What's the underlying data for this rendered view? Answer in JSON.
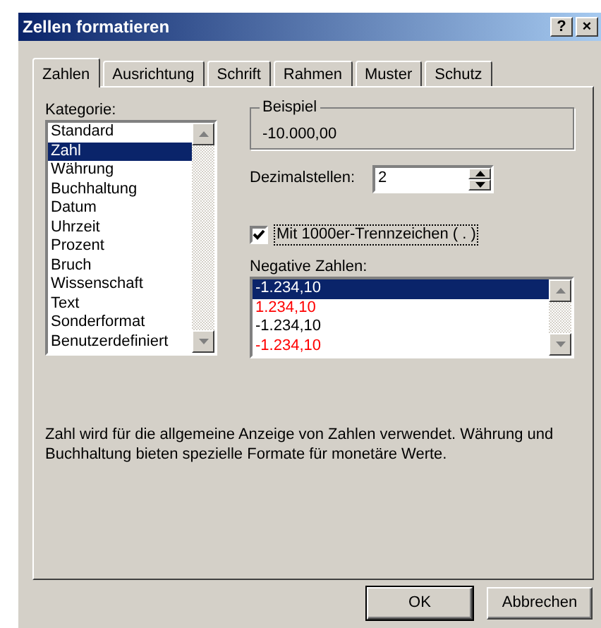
{
  "window": {
    "title": "Zellen formatieren",
    "title_buttons": [
      "?",
      "×"
    ]
  },
  "tabs": [
    {
      "label": "Zahlen",
      "selected": true
    },
    {
      "label": "Ausrichtung",
      "selected": false
    },
    {
      "label": "Schrift",
      "selected": false
    },
    {
      "label": "Rahmen",
      "selected": false
    },
    {
      "label": "Muster",
      "selected": false
    },
    {
      "label": "Schutz",
      "selected": false
    }
  ],
  "category": {
    "label": "Kategorie:",
    "items": [
      {
        "label": "Standard",
        "selected": false
      },
      {
        "label": "Zahl",
        "selected": true
      },
      {
        "label": "Währung",
        "selected": false
      },
      {
        "label": "Buchhaltung",
        "selected": false
      },
      {
        "label": "Datum",
        "selected": false
      },
      {
        "label": "Uhrzeit",
        "selected": false
      },
      {
        "label": "Prozent",
        "selected": false
      },
      {
        "label": "Bruch",
        "selected": false
      },
      {
        "label": "Wissenschaft",
        "selected": false
      },
      {
        "label": "Text",
        "selected": false
      },
      {
        "label": "Sonderformat",
        "selected": false
      },
      {
        "label": "Benutzerdefiniert",
        "selected": false
      }
    ]
  },
  "sample": {
    "label": "Beispiel",
    "value": "-10.000,00"
  },
  "decimal_places": {
    "label": "Dezimalstellen:",
    "value": "2"
  },
  "thousands_separator": {
    "label": "Mit 1000er-Trennzeichen ( . )",
    "checked": true
  },
  "negative_numbers": {
    "label": "Negative Zahlen:",
    "items": [
      {
        "label": "-1.234,10",
        "selected": true
      },
      {
        "label": "1.234,10",
        "selected": false,
        "color": "#ff0000"
      },
      {
        "label": "-1.234,10",
        "selected": false,
        "color": "#000000"
      },
      {
        "label": "-1.234,10",
        "selected": false,
        "color": "#ff0000"
      }
    ]
  },
  "description": "Zahl wird für die allgemeine Anzeige von Zahlen verwendet. Währung und Buchhaltung bieten spezielle Formate für monetäre Werte.",
  "buttons": [
    "OK",
    "Abbrechen"
  ]
}
